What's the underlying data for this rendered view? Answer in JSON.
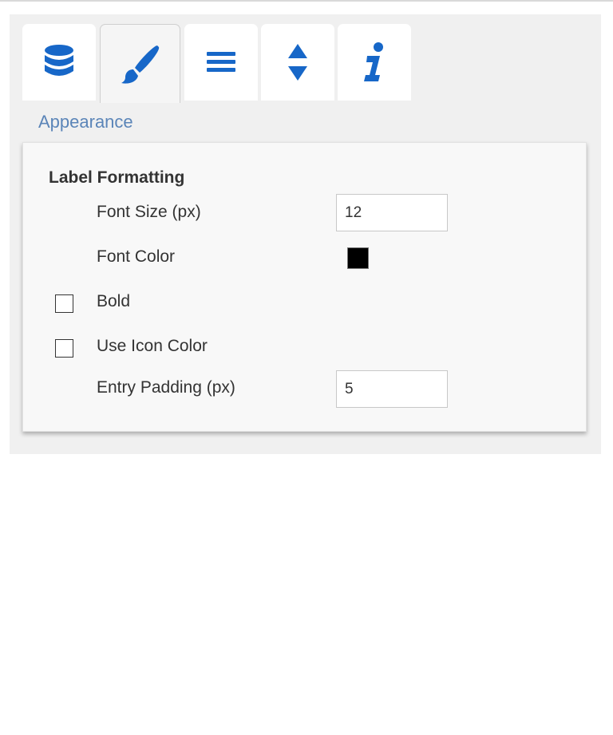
{
  "tabs": [
    {
      "name": "data",
      "icon": "database-icon",
      "active": false
    },
    {
      "name": "appearance",
      "icon": "paintbrush-icon",
      "active": true
    },
    {
      "name": "layout",
      "icon": "bars-icon",
      "active": false
    },
    {
      "name": "sort",
      "icon": "sort-arrows-icon",
      "active": false
    },
    {
      "name": "info",
      "icon": "info-icon",
      "active": false
    }
  ],
  "colors": {
    "accent": "#1767c8",
    "section_title": "#5b85b8",
    "panel_bg": "#f0f0f0",
    "card_bg": "#f8f8f8",
    "font_color_value": "#000000"
  },
  "section": {
    "title": "Appearance"
  },
  "label_formatting": {
    "title": "Label Formatting",
    "font_size": {
      "label": "Font Size (px)",
      "value": "12"
    },
    "font_color": {
      "label": "Font Color"
    },
    "bold": {
      "label": "Bold",
      "checked": false
    },
    "use_icon_color": {
      "label": "Use Icon Color",
      "checked": false
    },
    "entry_padding": {
      "label": "Entry Padding (px)",
      "value": "5"
    }
  }
}
